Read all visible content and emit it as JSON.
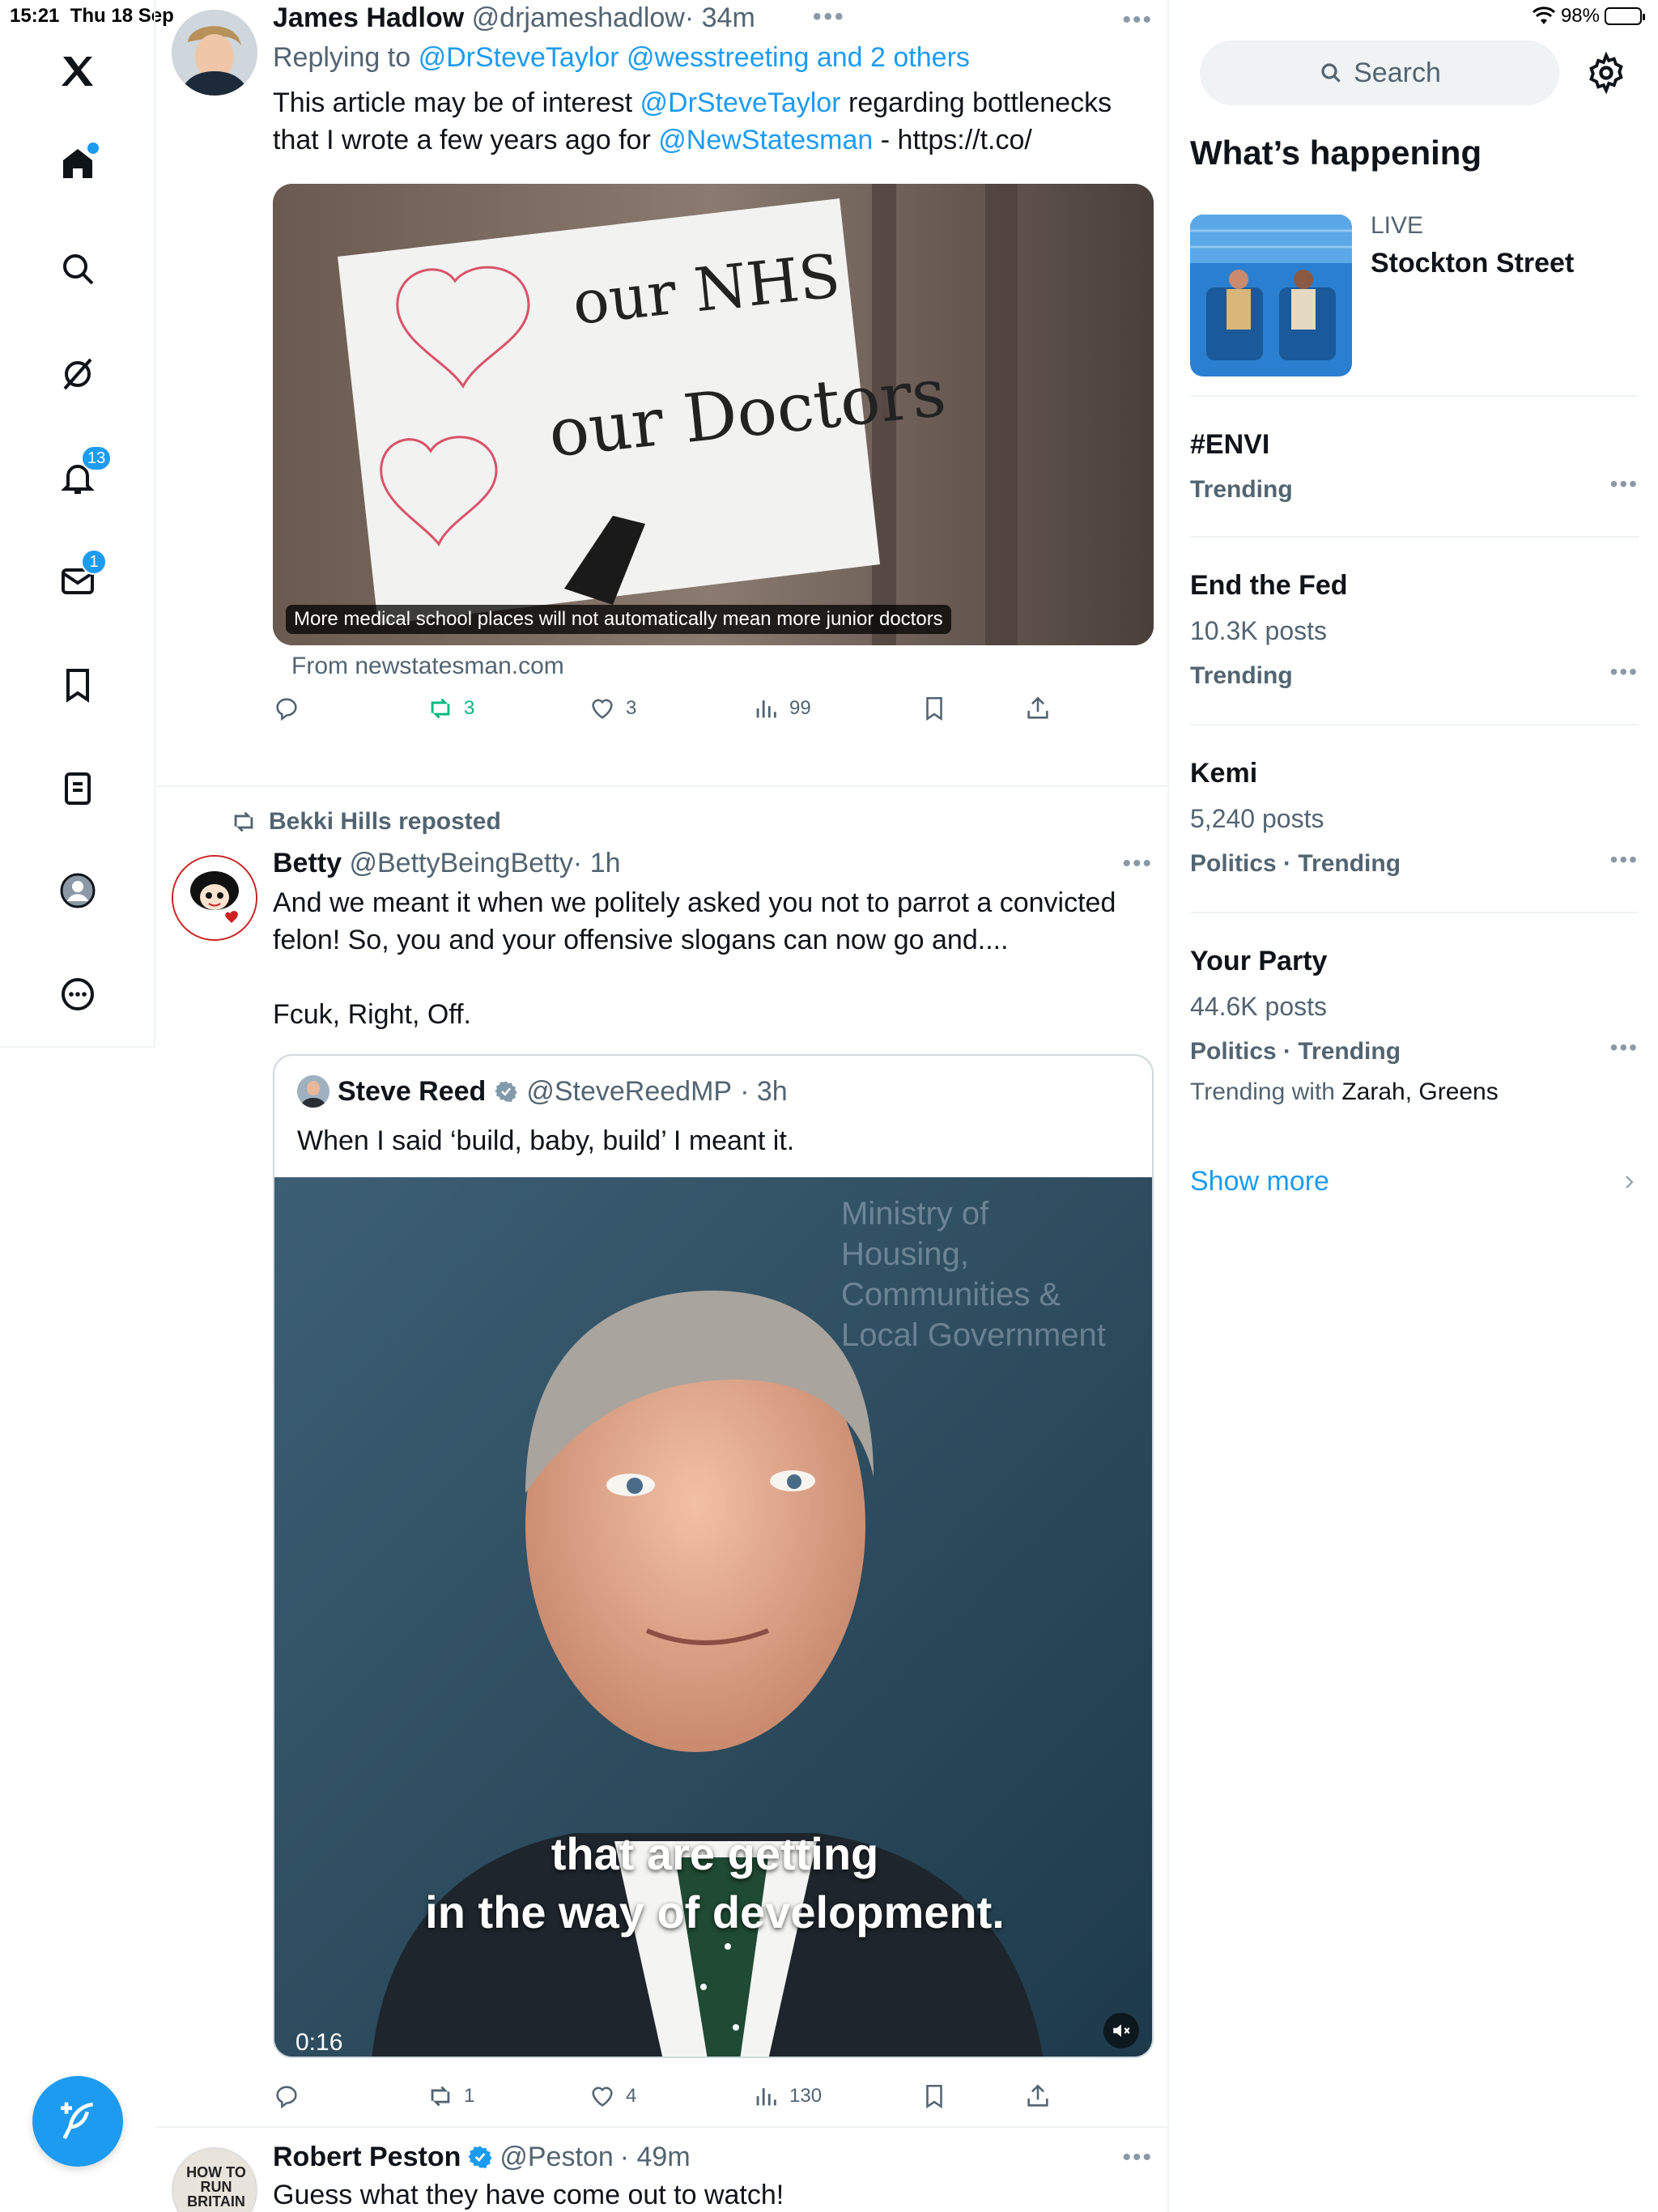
{
  "status": {
    "time": "15:21",
    "date": "Thu 18 Sep",
    "battery": "98%",
    "battery_level": 0.98
  },
  "nav": {
    "notifications_badge": "13",
    "messages_badge": "1"
  },
  "tweets": [
    {
      "name": "James Hadlow",
      "handle": "@drjameshadlow",
      "time": "· 34m",
      "reply_prefix": "Replying to",
      "reply_to": "@DrSteveTaylor @wesstreeting and 2 others",
      "text_1": "This article may be of interest",
      "mention_1": "@DrSteveTaylor",
      "text_2": "regarding bottlenecks",
      "text_3": "that I wrote a few years ago for",
      "mention_2": "@NewStatesman",
      "text_4": "- https://t.co/",
      "card_caption": "More medical school places will not automatically mean more junior doctors",
      "card_source": "From newstatesman.com",
      "sign_line_1": "our NHS",
      "sign_line_2": "our Doctors",
      "replies": "",
      "reposts": "3",
      "likes": "3",
      "views": "99"
    },
    {
      "repost_label": "Bekki Hills reposted",
      "name": "Betty",
      "handle": "@BettyBeingBetty",
      "time": "· 1h",
      "text_line_1": "And we meant it when we politely asked you not to parrot a convicted",
      "text_line_2": "felon! So, you and your offensive slogans can now go and....",
      "text_line_3": "Fcuk, Right, Off.",
      "quote": {
        "name": "Steve Reed",
        "handle": "@SteveReedMP",
        "time": "· 3h",
        "text": "When I said ‘build, baby, build’ I meant it.",
        "subtitle_1": "that are getting",
        "subtitle_2": "in the way of development.",
        "duration": "0:16",
        "bg_text": "Ministry of Housing, Communities & Local Government"
      },
      "reposts": "1",
      "likes": "4",
      "views": "130"
    },
    {
      "name": "Robert Peston",
      "handle": "@Peston",
      "time": "· 49m",
      "text": "Guess what they have come out to watch!",
      "avatar_text": "HOW TO RUN BRITAIN"
    }
  ],
  "sidebar": {
    "search_placeholder": "Search",
    "heading": "What’s happening",
    "live": {
      "label": "LIVE",
      "title": "Stockton Street"
    },
    "trends": [
      {
        "title": "#ENVI",
        "posts": "",
        "category": "Trending",
        "with_prefix": "",
        "with": ""
      },
      {
        "title": "End the Fed",
        "posts": "10.3K posts",
        "category": "Trending",
        "with_prefix": "",
        "with": ""
      },
      {
        "title": "Kemi",
        "posts": "5,240 posts",
        "category": "Politics · Trending",
        "with_prefix": "",
        "with": ""
      },
      {
        "title": "Your Party",
        "posts": "44.6K posts",
        "category": "Politics · Trending",
        "with_prefix": "Trending with",
        "with": "Zarah, Greens"
      }
    ],
    "show_more": "Show more"
  },
  "colors": {
    "accent": "#1d9bf0",
    "repost_green": "#00ba7c",
    "muted": "#536471"
  }
}
